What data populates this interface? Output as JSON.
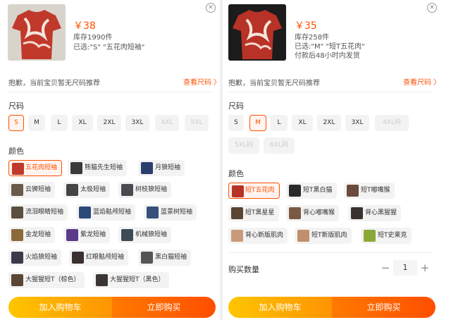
{
  "left": {
    "price": "￥38",
    "stock": "库存1990件",
    "selected": "已选:\"S\" \"五花肉短袖\"",
    "notice": "抱歉，当前宝贝暂无尺码推荐",
    "size_guide": "查看尺码 〉",
    "size_label": "尺码",
    "sizes": [
      "S",
      "M",
      "L",
      "XL",
      "2XL",
      "3XL",
      "4XL",
      "5XL"
    ],
    "color_label": "颜色",
    "colors": [
      "五花肉短袖",
      "熊猫先生短袖",
      "月狼短袖",
      "云狮短袖",
      "太极短袖",
      "树枝狼短袖",
      "流泪眼睛短袖",
      "蓝焰骷颅短袖",
      "蓝景树短袖",
      "金龙短袖",
      "紫龙短袖",
      "机械狼短袖",
      "火焰狼短袖",
      "红眼骷颅短袖",
      "黑白猫短袖",
      "大猩猩短T（棕色）",
      "大猩猩短T（黑色）"
    ],
    "add_cart": "加入购物车",
    "buy_now": "立即购买"
  },
  "right": {
    "price": "￥35",
    "stock": "库存258件",
    "selected": "已选:\"M\" \"短T五花肉\"",
    "shipping": "付款后48小时内发货",
    "notice": "抱歉，当前宝贝暂无尺码推荐",
    "size_guide": "查看尺码 〉",
    "size_label": "尺码",
    "sizes": [
      "S",
      "M",
      "L",
      "XL",
      "2XL",
      "3XL",
      "4XL码",
      "5XL码",
      "6XL码"
    ],
    "color_label": "颜色",
    "colors": [
      "短T五花肉",
      "短T黑白猫",
      "短T嘟嘴猴",
      "短T黑星星",
      "背心嘟嘴猴",
      "背心黑猩猩",
      "背心新版肌肉",
      "短T新版肌肉",
      "短T史莱克"
    ],
    "qty_label": "购买数量",
    "quantity": "1",
    "minus": "−",
    "plus": "+",
    "add_cart": "加入购物车",
    "buy_now": "立即购买"
  },
  "close_glyph": "✕",
  "accent_color": "#ff5000"
}
